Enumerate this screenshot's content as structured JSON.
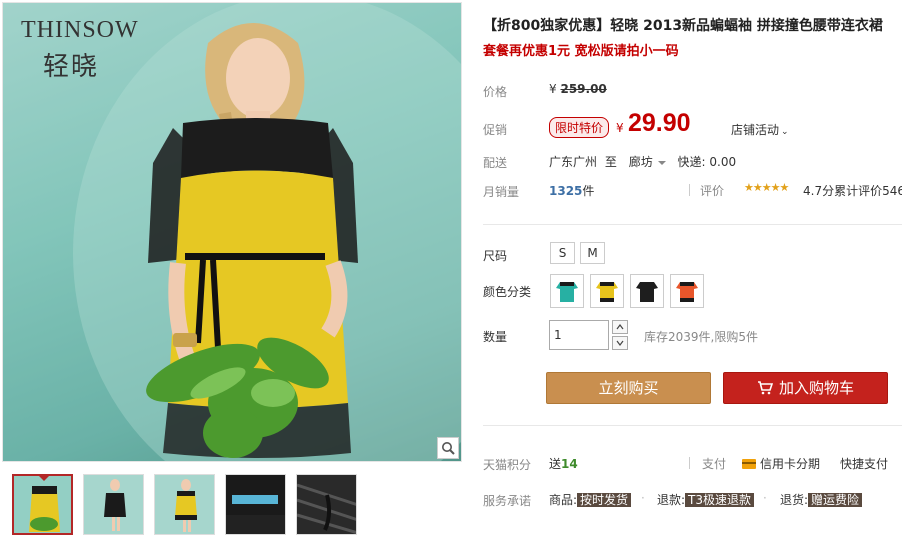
{
  "brand": {
    "en": "THINSOW",
    "cn": "轻晓"
  },
  "title": "【折800独家优惠】轻晓 2013新品蝙蝠袖 拼接撞色腰带连衣裙",
  "subtitle": "套餐再优惠1元 宽松版请拍小一码",
  "price": {
    "label": "价格",
    "yen": "¥",
    "original": "259.00",
    "promo_label": "促销",
    "promo_tag": "限时特价",
    "promo_price": "29.90",
    "shop_activity": "店铺活动"
  },
  "shipping": {
    "label": "配送",
    "from": "广东广州",
    "to_word": "至",
    "dest": "廊坊",
    "fee": "快递: 0.00"
  },
  "sales": {
    "label": "月销量",
    "count": "1325",
    "unit": "件",
    "rating_label": "评价",
    "stars": "★★★★★",
    "rating_text": "4.7分累计评价546"
  },
  "options": {
    "size_label": "尺码",
    "sizes": [
      "S",
      "M"
    ],
    "color_label": "颜色分类",
    "color_names": [
      "teal-dress-swatch",
      "yellow-dress-swatch",
      "black-dress-swatch",
      "orange-dress-swatch"
    ],
    "colors": [
      "#27b0a3",
      "#e6c31c",
      "#1e1e1e",
      "#e8562b"
    ]
  },
  "quantity": {
    "label": "数量",
    "value": "1",
    "stock": "库存2039件,限购5件"
  },
  "actions": {
    "buy": "立刻购买",
    "cart": "加入购物车"
  },
  "points": {
    "label": "天猫积分",
    "send": "送",
    "value": "14"
  },
  "payment": {
    "label": "支付",
    "credit": "信用卡分期",
    "fast": "快捷支付"
  },
  "service": {
    "label": "服务承诺",
    "items": [
      {
        "prefix": "商品:",
        "tag": "按时发货"
      },
      {
        "prefix": "退款:",
        "tag": "T3极速退款"
      },
      {
        "prefix": "退货:",
        "tag": "赠运费险"
      }
    ]
  },
  "thumbnails": [
    "thumb-front",
    "thumb-black",
    "thumb-yellow-side",
    "thumb-detail-blue",
    "thumb-detail-black"
  ]
}
